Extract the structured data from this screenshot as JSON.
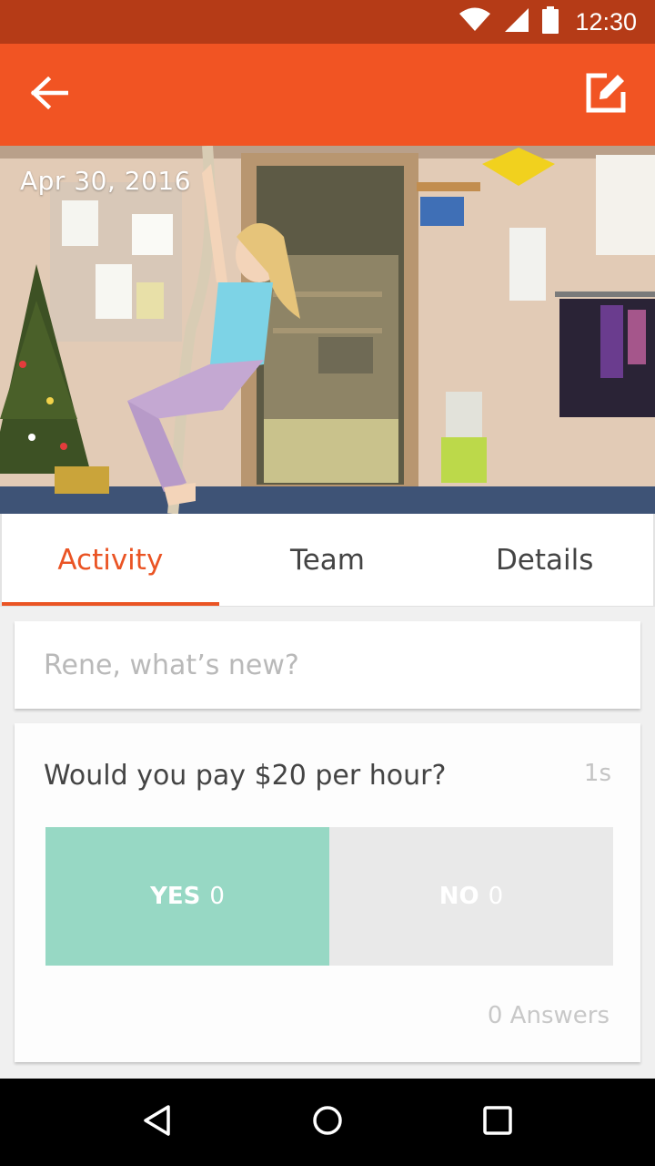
{
  "status_bar": {
    "time": "12:30",
    "icons": [
      "wifi-icon",
      "signal-icon",
      "battery-icon"
    ]
  },
  "app_bar": {
    "back_icon": "arrow-left-icon",
    "edit_icon": "edit-icon",
    "background": "#f15423"
  },
  "hero": {
    "date": "Apr 30, 2016"
  },
  "tabs": [
    {
      "label": "Activity",
      "active": true
    },
    {
      "label": "Team",
      "active": false
    },
    {
      "label": "Details",
      "active": false
    }
  ],
  "composer": {
    "placeholder": "Rene, what’s new?"
  },
  "poll": {
    "question": "Would you pay $20 per hour?",
    "time_ago": "1s",
    "yes_label": "YES",
    "yes_count": "0",
    "no_label": "NO",
    "no_count": "0",
    "answers": "0 Answers",
    "yes_color": "#97d8c4",
    "no_color": "#e9e9e9"
  },
  "nav_bar": {
    "icons": [
      "back-triangle-icon",
      "home-circle-icon",
      "recents-square-icon"
    ]
  },
  "colors": {
    "status_bar": "#b53b17",
    "accent": "#ea5424"
  }
}
